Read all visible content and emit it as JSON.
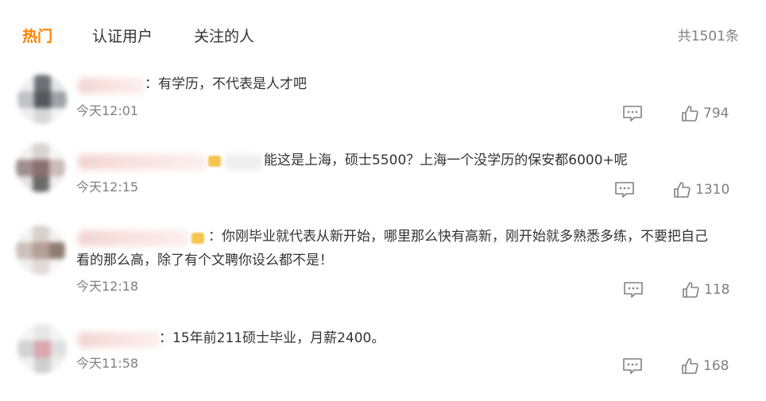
{
  "tabs": [
    {
      "label": "热门",
      "active": true
    },
    {
      "label": "认证用户",
      "active": false
    },
    {
      "label": "关注的人",
      "active": false
    }
  ],
  "total_count": "共1501条",
  "colors": {
    "accent": "#ff8200",
    "text": "#333333",
    "muted": "#808080"
  },
  "comments": [
    {
      "text": "：有学历，不代表是人才吧",
      "time": "今天12:01",
      "likes": "794",
      "reply_icon": "comment-icon",
      "like_icon": "thumbs-up-icon"
    },
    {
      "text": "能这是上海，硕士5500？上海一个没学历的保安都6000+呢",
      "time": "今天12:15",
      "likes": "1310",
      "reply_icon": "comment-icon",
      "like_icon": "thumbs-up-icon"
    },
    {
      "text_line1": "：你刚毕业就代表从新开始，哪里那么快有高新，刚开始就多熟悉多练，不要把自己",
      "text_line2": "看的那么高，除了有个文聘你设么都不是！",
      "time": "今天12:18",
      "likes": "118",
      "reply_icon": "comment-icon",
      "like_icon": "thumbs-up-icon"
    },
    {
      "text": "：15年前211硕士毕业，月薪2400。",
      "time": "今天11:58",
      "likes": "168",
      "reply_icon": "comment-icon",
      "like_icon": "thumbs-up-icon"
    }
  ]
}
